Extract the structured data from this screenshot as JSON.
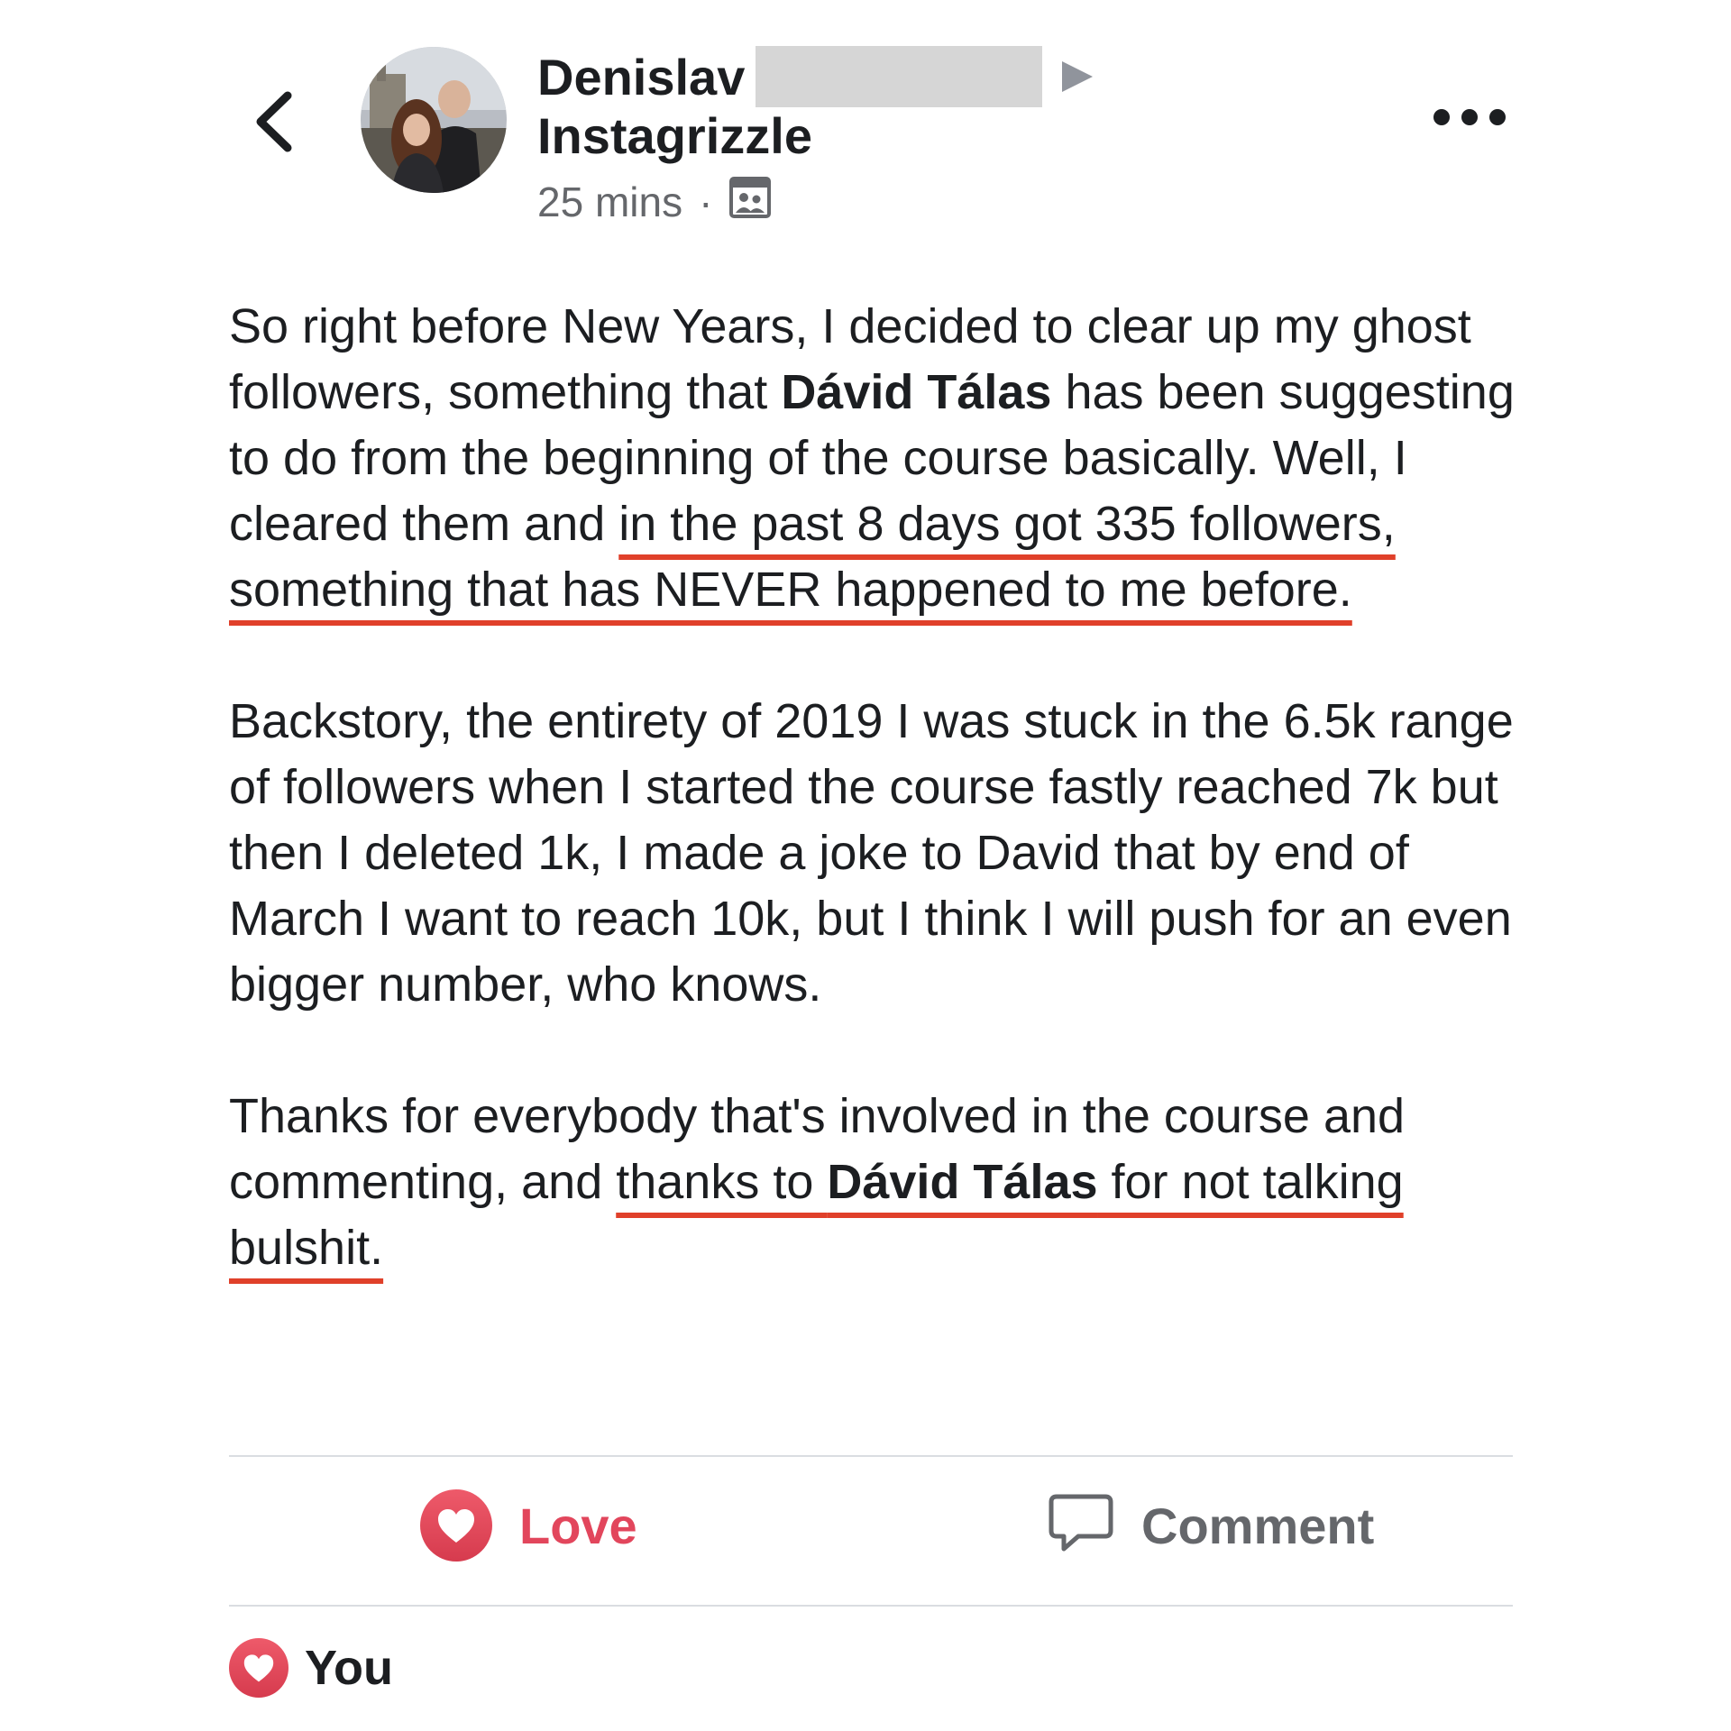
{
  "header": {
    "author_first_name": "Denislav",
    "group_name": "Instagrizzle",
    "timestamp": "25 mins",
    "meta_separator": "·",
    "audience_icon": "group-audience-icon"
  },
  "post": {
    "p1_a": "So right before New Years, I decided to clear up my ghost followers, something that ",
    "p1_mention": "Dávid Tálas",
    "p1_b": " has been suggesting to do from the beginning of the course basically. Well, I cleared them and ",
    "p1_highlight": "in the past 8 days got 335 followers, something that has NEVER happened to me before.",
    "p2": "Backstory, the entirety of 2019 I was stuck in the 6.5k range of followers when I started the course fastly reached 7k but then I deleted 1k, I made a joke to David that by end of March I want to reach 10k, but I think I will push for an even bigger number, who knows.",
    "p3_a": "Thanks for everybody that's involved in the course and commenting, and ",
    "p3_h1": "thanks to ",
    "p3_mention": "Dávid Tálas",
    "p3_h2": " for not talking bulshit."
  },
  "actions": {
    "love_label": "Love",
    "comment_label": "Comment"
  },
  "reactions": {
    "label": "You"
  },
  "colors": {
    "underline": "#e0402a",
    "love": "#e2465c",
    "muted": "#65676b",
    "divider": "#dadde1"
  }
}
